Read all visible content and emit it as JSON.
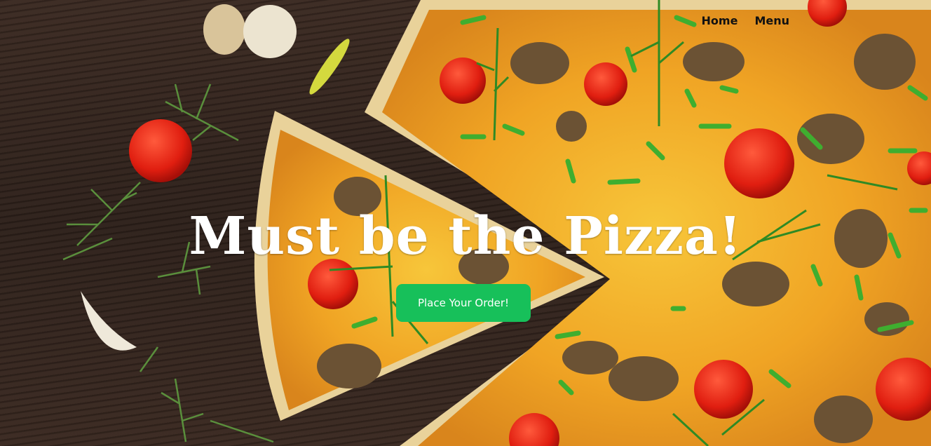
{
  "nav": {
    "home_label": "Home",
    "menu_label": "Menu"
  },
  "hero": {
    "headline": "Must be the Pizza!",
    "cta_label": "Place Your Order!",
    "background_image": "pizza-on-wooden-table"
  },
  "colors": {
    "cta_background": "#17c05a",
    "headline_text": "#ffffff",
    "nav_text": "#111111"
  }
}
